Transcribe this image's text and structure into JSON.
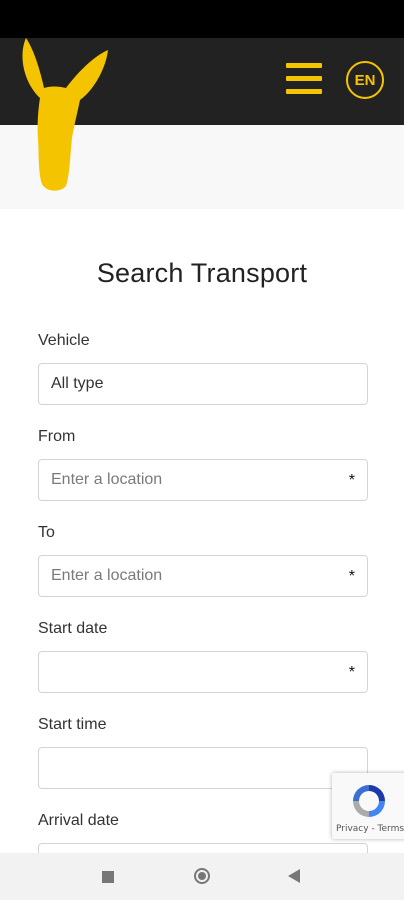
{
  "header": {
    "language_label": "EN"
  },
  "main": {
    "title": "Search Transport",
    "fields": {
      "vehicle": {
        "label": "Vehicle",
        "value": "All type"
      },
      "from": {
        "label": "From",
        "placeholder": "Enter a location",
        "required_mark": "*"
      },
      "to": {
        "label": "To",
        "placeholder": "Enter a location",
        "required_mark": "*"
      },
      "start_date": {
        "label": "Start date",
        "required_mark": "*"
      },
      "start_time": {
        "label": "Start time"
      },
      "arrival_date": {
        "label": "Arrival date"
      }
    }
  },
  "recaptcha": {
    "terms": "Privacy - Terms"
  },
  "colors": {
    "brand_yellow": "#f5c400",
    "header_bg": "#222222"
  }
}
